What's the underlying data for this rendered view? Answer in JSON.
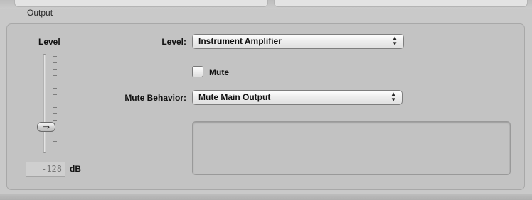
{
  "output_group": {
    "title": "Output"
  },
  "level_slider": {
    "title": "Level",
    "value": "-128",
    "unit": "dB",
    "thumb_glyph": "⇒",
    "level_fraction": 0.25
  },
  "level_field": {
    "label": "Level:",
    "selected": "Instrument Amplifier",
    "arrows_icon": "up-down-arrows"
  },
  "mute": {
    "label": "Mute",
    "checked": false
  },
  "mute_behavior": {
    "label": "Mute Behavior:",
    "selected": "Mute Main Output"
  }
}
